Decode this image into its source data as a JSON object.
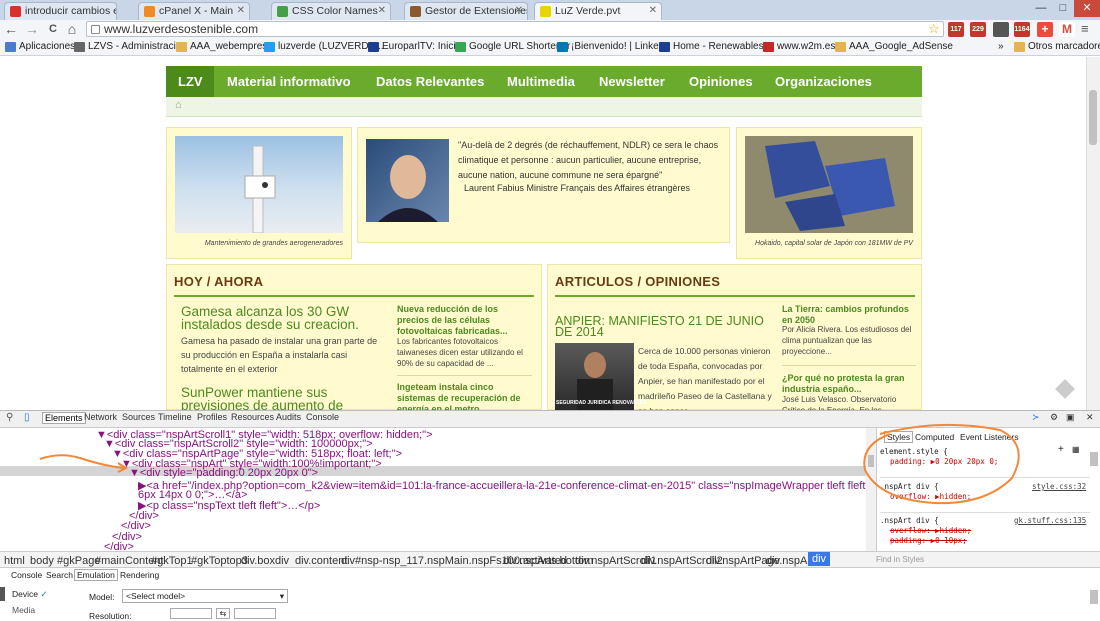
{
  "tabs": [
    {
      "label": "introducir cambios en un",
      "color": "#d9302c"
    },
    {
      "label": "cPanel X - Main",
      "color": "#f08a24"
    },
    {
      "label": "CSS Color Names",
      "color": "#45a047"
    },
    {
      "label": "Gestor de Extensiones: Ins",
      "color": "#8a5a2c"
    },
    {
      "label": "LuZ Verde.pvt",
      "color": "#e8d400"
    }
  ],
  "window": {
    "min": "—",
    "max": "□",
    "close": "✕"
  },
  "toolbar": {
    "url": "www.luzverdesostenible.com",
    "back": "←",
    "forward": "→",
    "reload": "C",
    "home": "⌂"
  },
  "extensions": [
    {
      "badge": "117",
      "color": "#c0392b"
    },
    {
      "badge": "229",
      "color": "#c0392b"
    },
    {
      "badge": "",
      "color": "#555555"
    },
    {
      "badge": "1164",
      "color": "#c0392b"
    },
    {
      "badge": "+",
      "color": "#e74c3c"
    },
    {
      "badge": "M",
      "color": "#d54b3d"
    }
  ],
  "bookmarks": [
    {
      "label": "Aplicaciones",
      "color": "#4a7bd1"
    },
    {
      "label": "LZVS - Administraci...",
      "color": "#666666"
    },
    {
      "label": "AAA_webempresa",
      "color": "#e5b44a"
    },
    {
      "label": "luzverde (LUZVERDE...",
      "color": "#1da1f2"
    },
    {
      "label": "EuroparlTV: Inicio",
      "color": "#1c3f94"
    },
    {
      "label": "Google URL Shortener",
      "color": "#34a853"
    },
    {
      "label": "¡Bienvenido! | Linke...",
      "color": "#0077b5"
    },
    {
      "label": "Home - Renewables...",
      "color": "#1c3f94"
    },
    {
      "label": "www.w2m.es",
      "color": "#c62828"
    },
    {
      "label": "AAA_Google_AdSense",
      "color": "#e5b44a"
    }
  ],
  "bookmarks_more": "»",
  "bookmarks_other": "Otros marcadores",
  "site": {
    "nav": [
      "LZV",
      "Material informativo",
      "Datos Relevantes",
      "Multimedia",
      "Newsletter",
      "Opiniones",
      "Organizaciones"
    ],
    "caption_left": "Mantenimiento de grandes aerogeneradores",
    "quote": "\"Au-delà de 2 degrés (de réchauffement, NDLR) ce sera le chaos climatique et personne : aucun particulier, aucune entreprise, aucune nation, aucune commune ne sera épargné\"",
    "quote_author": "Laurent Fabius Ministre Français des Affaires étrangères",
    "caption_right": "Hokaido, capital solar de Japón con 181MW de PV",
    "hoy_title": "HOY / AHORA",
    "hoy_main_title": "Gamesa alcanza los 30 GW instalados desde su creacion.",
    "hoy_main_body": "Gamesa ha pasado de instalar una gran parte de su producción en España a instalarla casi totalmente en el exterior",
    "hoy_second_title": "SunPower mantiene sus previsiones de aumento de",
    "hoy_side1_title": "Nueva reducción de los precios de las células fotovoltaicas fabricadas...",
    "hoy_side1_body": "Los fabricantes fotovoltaicos taiwaneses dicen estar utilizando el 90% de su capacidad de ...",
    "hoy_side2_title": "Ingeteam instala cinco sistemas de recuperación de energía en el metro...",
    "art_title": "ARTICULOS / OPINIONES",
    "art_main_title": "ANPIER: MANIFIESTO 21 DE JUNIO DE 2014",
    "art_main_body": "Cerca de 10.000 personas vinieron de toda España, convocadas por Anpier, se han manifestado por el madrileño Paseo de la Castellana y se han conce...",
    "art_img_caption": "SEGURIDAD JURIDICA RENOVABLES",
    "art_side1_title": "La Tierra: cambios profundos en 2050",
    "art_side1_body": "Por Alicia Rivera. Los estudiosos del clima puntualizan que las proyeccione...",
    "art_side2_title": "¿Por qué no protesta la gran industria españo...",
    "art_side2_body": "José Luis Velasco.  Observatorio Crítico de la Energía. En los"
  },
  "devtools": {
    "tabs": [
      "Elements",
      "Network",
      "Sources",
      "Timeline",
      "Profiles",
      "Resources",
      "Audits",
      "Console"
    ],
    "dom": [
      {
        "t": "▼<div class=\"nspArtScroll1\" style=\"width: 518px; overflow: hidden;\">"
      },
      {
        "t": "▼<div class=\"nspArtScroll2\" style=\"width: 100000px;\">"
      },
      {
        "t": "▼<div class=\"nspArtPage\" style=\"width: 518px; float: left;\">"
      },
      {
        "t": "▼<div class=\"nspArt\" style=\"width:100%!important;\">"
      },
      {
        "t": "▼<div style=\"padding:0 20px 20px 0\">"
      },
      {
        "t": "▶<a href=\"/index.php?option=com_k2&view=item&id=101:la-france-accueillera-la-21e-conference-climat-en-2015\" class=\"nspImageWrapper tleft fleft\" style=\"margin:"
      },
      {
        "t": "6px 14px 0 0;\">…</a>"
      },
      {
        "t": "▶<p class=\"nspText tleft fleft\">…</p>"
      },
      {
        "t": "</div>"
      },
      {
        "t": "</div>"
      },
      {
        "t": "</div>"
      },
      {
        "t": "</div>"
      }
    ],
    "styles_tabs": [
      "Styles",
      "Computed",
      "Event Listeners"
    ],
    "rule1_selector": "element.style {",
    "rule1_prop": "padding: ▶0 20px 20px 0;",
    "rule2_selector": ".nspArt div {",
    "rule2_prop": "overflow: ▶hidden;",
    "rule2_source": "style.css:32",
    "rule3_selector": ".nspArt div {",
    "rule3_prop1": "overflow: ▶hidden;",
    "rule3_prop2": "padding: ▶0 10px;",
    "rule3_source": "gk.stuff.css:135",
    "breadcrumbs": [
      "html",
      "body",
      "#gkPage",
      "#mainContent",
      "#gkTop1",
      "#gkToptop3",
      "div.box",
      "div",
      "div.content",
      "div#nsp-nsp_117.nspMain.nspFs100.activated",
      "div.nspArts.bottom",
      "div.nspArtScroll1",
      "div.nspArtScroll2",
      "div.nspArtPage",
      "div.nspArt",
      "div"
    ],
    "drawer_tabs": [
      "Console",
      "Search",
      "Emulation",
      "Rendering"
    ],
    "drawer_side": [
      "Device",
      "Media"
    ],
    "model_label": "Model:",
    "model_value": "<Select model>",
    "resolution_label": "Resolution:",
    "find_placeholder": "Find in Styles",
    "close": "✕"
  }
}
